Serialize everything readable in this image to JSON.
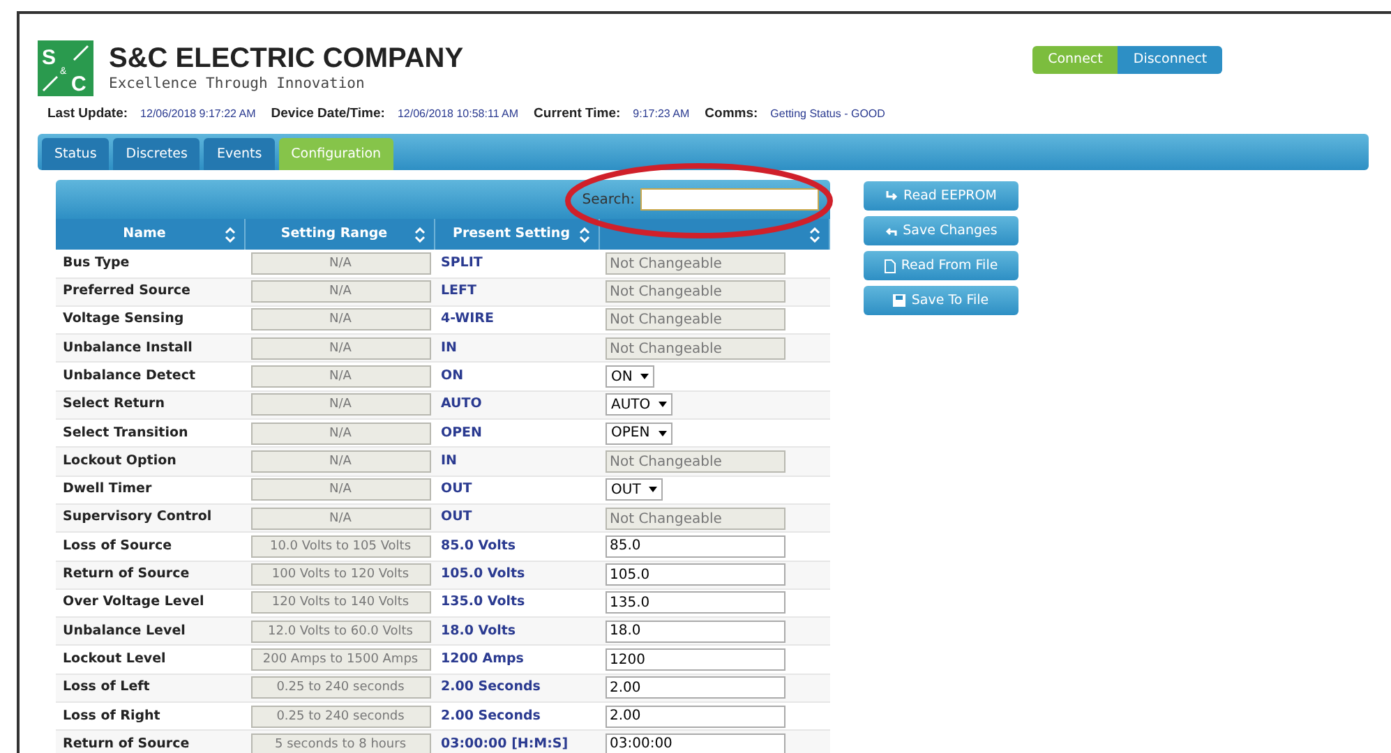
{
  "header": {
    "company": "S&C ELECTRIC COMPANY",
    "tagline": "Excellence Through Innovation",
    "logo_letters": [
      "S",
      "&",
      "C"
    ]
  },
  "connection_buttons": [
    {
      "label": "Connect",
      "selected": true
    },
    {
      "label": "Disconnect",
      "selected": false
    }
  ],
  "status_line": [
    {
      "label": "Last Update:",
      "value": "12/06/2018 9:17:22 AM"
    },
    {
      "label": "Device Date/Time:",
      "value": "12/06/2018 10:58:11 AM"
    },
    {
      "label": "Current Time:",
      "value": "9:17:23 AM"
    },
    {
      "label": "Comms:",
      "value": "Getting Status - GOOD"
    }
  ],
  "tabs": [
    {
      "label": "Status",
      "selected": false
    },
    {
      "label": "Discretes",
      "selected": false
    },
    {
      "label": "Events",
      "selected": false
    },
    {
      "label": "Configuration",
      "selected": true
    }
  ],
  "search": {
    "label": "Search:"
  },
  "table": {
    "columns": [
      "Name",
      "Setting Range",
      "Present Setting"
    ],
    "rows": [
      {
        "name": "Bus Type",
        "range": "N/A",
        "present": "SPLIT",
        "kind": "readonly",
        "new": "Not Changeable"
      },
      {
        "name": "Preferred Source",
        "range": "N/A",
        "present": "LEFT",
        "kind": "readonly",
        "new": "Not Changeable"
      },
      {
        "name": "Voltage Sensing",
        "range": "N/A",
        "present": "4-WIRE",
        "kind": "readonly",
        "new": "Not Changeable"
      },
      {
        "name": "Unbalance Install",
        "range": "N/A",
        "present": "IN",
        "kind": "readonly",
        "new": "Not Changeable"
      },
      {
        "name": "Unbalance Detect",
        "range": "N/A",
        "present": "ON",
        "kind": "select",
        "new": "ON"
      },
      {
        "name": "Select Return",
        "range": "N/A",
        "present": "AUTO",
        "kind": "select",
        "new": "AUTO"
      },
      {
        "name": "Select Transition",
        "range": "N/A",
        "present": "OPEN",
        "kind": "select",
        "new": "OPEN"
      },
      {
        "name": "Lockout Option",
        "range": "N/A",
        "present": "IN",
        "kind": "readonly",
        "new": "Not Changeable"
      },
      {
        "name": "Dwell Timer",
        "range": "N/A",
        "present": "OUT",
        "kind": "select",
        "new": "OUT"
      },
      {
        "name": "Supervisory Control",
        "range": "N/A",
        "present": "OUT",
        "kind": "readonly",
        "new": "Not Changeable"
      },
      {
        "name": "Loss of Source",
        "range": "10.0 Volts to 105 Volts",
        "present": "85.0 Volts",
        "kind": "input",
        "new": "85.0"
      },
      {
        "name": "Return of Source",
        "range": "100 Volts to 120 Volts",
        "present": "105.0 Volts",
        "kind": "input",
        "new": "105.0"
      },
      {
        "name": "Over Voltage Level",
        "range": "120 Volts to 140 Volts",
        "present": "135.0 Volts",
        "kind": "input",
        "new": "135.0"
      },
      {
        "name": "Unbalance Level",
        "range": "12.0 Volts to 60.0 Volts",
        "present": "18.0 Volts",
        "kind": "input",
        "new": "18.0"
      },
      {
        "name": "Lockout Level",
        "range": "200 Amps to 1500 Amps",
        "present": "1200 Amps",
        "kind": "input",
        "new": "1200"
      },
      {
        "name": "Loss of Left",
        "range": "0.25 to 240 seconds",
        "present": "2.00 Seconds",
        "kind": "input",
        "new": "2.00"
      },
      {
        "name": "Loss of Right",
        "range": "0.25 to 240 seconds",
        "present": "2.00 Seconds",
        "kind": "input",
        "new": "2.00"
      },
      {
        "name": "Return of Source",
        "range": "5 seconds to 8 hours",
        "present": "03:00:00 [H:M:S]",
        "kind": "input",
        "new": "03:00:00"
      }
    ]
  },
  "actions": [
    {
      "label": "Read EEPROM",
      "kind": "read"
    },
    {
      "label": "Save Changes",
      "kind": "save"
    },
    {
      "label": "Read From File",
      "kind": "file"
    },
    {
      "label": "Save To File",
      "kind": "disk"
    }
  ]
}
